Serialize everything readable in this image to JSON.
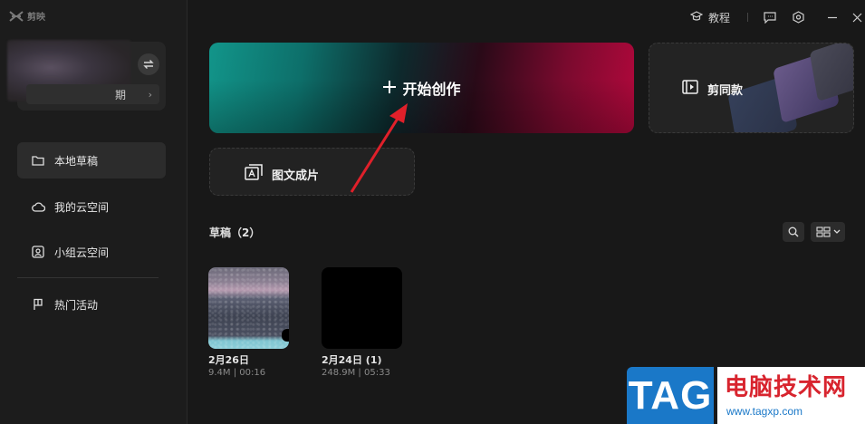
{
  "app": {
    "name": "剪映"
  },
  "window": {
    "tutorial_label": "教程"
  },
  "profile": {
    "sub_fragment": "期",
    "chevron": "›"
  },
  "sidebar": {
    "items": [
      {
        "label": "本地草稿",
        "icon": "folder-icon",
        "active": true
      },
      {
        "label": "我的云空间",
        "icon": "cloud-icon",
        "active": false
      },
      {
        "label": "小组云空间",
        "icon": "group-cloud-icon",
        "active": false
      },
      {
        "label": "热门活动",
        "icon": "flag-icon",
        "active": false
      }
    ]
  },
  "main": {
    "create_label": "开始创作",
    "template_label": "剪同款",
    "imgtext_label": "图文成片"
  },
  "drafts": {
    "title": "草稿（2）",
    "items": [
      {
        "name": "2月26日",
        "meta": "9.4M | 00:16"
      },
      {
        "name": "2月24日 (1)",
        "meta": "248.9M | 05:33"
      }
    ]
  },
  "watermark": {
    "tag": "TAG",
    "site_name": "电脑技术网",
    "url": "www.tagxp.com"
  },
  "colors": {
    "accent_teal": "#12958a",
    "accent_red": "#b2083c",
    "annotation_red": "#e0202a"
  }
}
